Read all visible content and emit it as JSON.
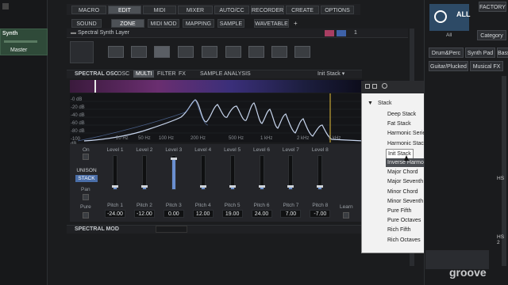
{
  "top_tabs": [
    {
      "label": "MACRO",
      "active": false
    },
    {
      "label": "EDIT",
      "active": true
    },
    {
      "label": "MIDI",
      "active": false
    },
    {
      "label": "MIXER",
      "active": false
    },
    {
      "label": "AUTO/CC",
      "active": false
    },
    {
      "label": "RECORDER",
      "active": false
    },
    {
      "label": "CREATE",
      "active": false
    },
    {
      "label": "OPTIONS",
      "active": false
    }
  ],
  "sub_tabs": [
    {
      "label": "SOUND",
      "active": false
    },
    {
      "label": "ZONE",
      "active": true
    },
    {
      "label": "MIDI MOD",
      "active": false
    },
    {
      "label": "MAPPING",
      "active": false
    },
    {
      "label": "SAMPLE",
      "active": false
    },
    {
      "label": "WAVETABLE",
      "active": false
    }
  ],
  "sub_tabs_add": "+",
  "layer_name": "Spectral Synth Layer",
  "layer_counter": "1",
  "left_track": {
    "name": "Synth",
    "output": "Master"
  },
  "spectral_osc": {
    "title": "SPECTRAL OSC",
    "tabs": [
      "OSC",
      "MULTI",
      "FILTER",
      "FX"
    ],
    "active_tab": "MULTI",
    "tabs2": [
      "SAMPLE",
      "ANALYSIS"
    ],
    "preset": "Init Stack"
  },
  "spectrum": {
    "db_labels": [
      "-0 dB",
      "-20 dB",
      "-40 dB",
      "-60 dB",
      "-80 dB",
      "-100 dB"
    ],
    "freq_labels": [
      "20 Hz",
      "50 Hz",
      "100 Hz",
      "200 Hz",
      "500 Hz",
      "1 kHz",
      "2 kHz",
      "5 kHz"
    ]
  },
  "on_label": "On",
  "unison_label": "UNISON",
  "stack_label": "STACK",
  "pan_label": "Pan",
  "pure_label": "Pure",
  "learn_label": "Learn",
  "levels": [
    {
      "label": "Level 1",
      "value": 0.05,
      "pitch_label": "Pitch 1",
      "pitch": "-24.00"
    },
    {
      "label": "Level 2",
      "value": 0.05,
      "pitch_label": "Pitch 2",
      "pitch": "-12.00"
    },
    {
      "label": "Level 3",
      "value": 0.92,
      "pitch_label": "Pitch 3",
      "pitch": "0.00"
    },
    {
      "label": "Level 4",
      "value": 0.05,
      "pitch_label": "Pitch 4",
      "pitch": "12.00"
    },
    {
      "label": "Level 5",
      "value": 0.05,
      "pitch_label": "Pitch 5",
      "pitch": "19.00"
    },
    {
      "label": "Level 6",
      "value": 0.05,
      "pitch_label": "Pitch 6",
      "pitch": "24.00"
    },
    {
      "label": "Level 7",
      "value": 0.05,
      "pitch_label": "Pitch 7",
      "pitch": "7.00"
    },
    {
      "label": "Level 8",
      "value": 0.05,
      "pitch_label": "Pitch 8",
      "pitch": "-7.00"
    }
  ],
  "spectral_mod": {
    "title": "SPECTRAL MOD"
  },
  "stack_menu": {
    "folder": "Stack",
    "items": [
      "Deep Stack",
      "Fat Stack",
      "Harmonic Series",
      "Harmonic Stack",
      "Init Stack",
      "Inverse Harmonic",
      "Major Chord",
      "Major Seventh Chord",
      "Minor Chord",
      "Minor Seventh Chord",
      "Pure Fifth",
      "Pure Octaves",
      "Rich Fifth",
      "Rich Octaves"
    ],
    "selected": "Init Stack",
    "hovered": "Inverse Harmonic",
    "close": "⊗",
    "nav": "|◂◂"
  },
  "right_panel": {
    "factory": "FACTORY",
    "all": "ALL",
    "all_sub": "All",
    "category": "Category",
    "tags": [
      "Drum&Perc",
      "Synth Pad",
      "Bass",
      "Guitar/Plucked",
      "Musical FX"
    ],
    "hs_label": "HS 2",
    "hs_label2": "HS"
  },
  "watermark": "groove",
  "colors": {
    "accent": "#6a8fd0",
    "bg": "#1b1c1e",
    "menu_bg": "#f2f2f2"
  }
}
